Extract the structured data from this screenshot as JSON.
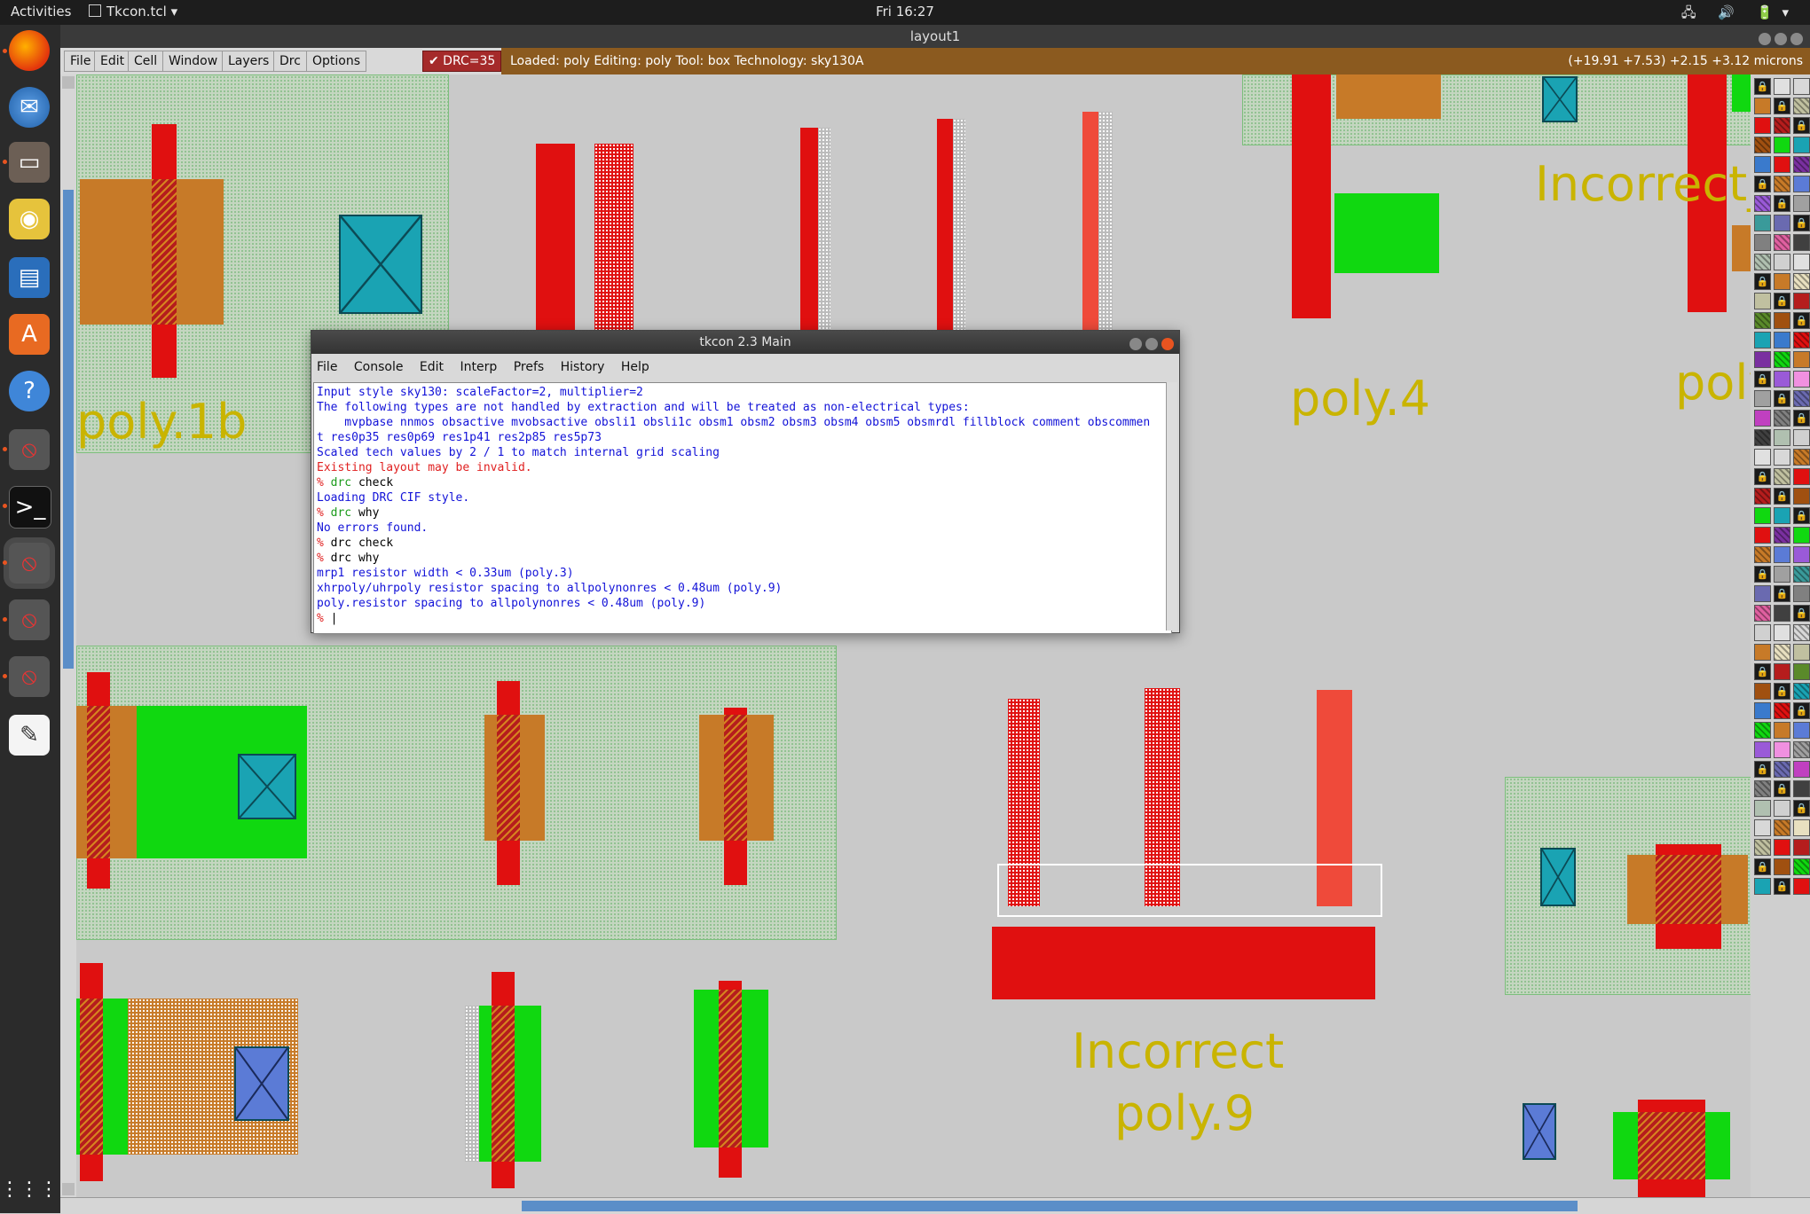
{
  "topbar": {
    "activities": "Activities",
    "app_menu": "Tkcon.tcl ▾",
    "clock": "Fri 16:27",
    "tray": "🖧 🔊 🔋▾"
  },
  "dock": {
    "icons": [
      "firefox-icon",
      "thunderbird-icon",
      "files-icon",
      "rhythmbox-icon",
      "libreoffice-writer-icon",
      "software-center-icon",
      "help-icon",
      "tk-app-icon",
      "terminal-icon",
      "tk-app-icon",
      "tk-app-icon",
      "tk-app-icon",
      "text-editor-icon",
      "show-apps-icon"
    ]
  },
  "window": {
    "title": "layout1"
  },
  "menubar": {
    "items": [
      "File",
      "Edit",
      "Cell",
      "Window",
      "Layers",
      "Drc",
      "Options"
    ],
    "drc_badge": "✔ DRC=35",
    "status": "Loaded: poly Editing: poly Tool: box  Technology: sky130A",
    "coords": "(+19.91 +7.53) +2.15 +3.12 microns"
  },
  "canvas": {
    "labels": {
      "poly1b": "poly.1b",
      "poly4": "poly.4",
      "poly_right": "poly",
      "incorrect_top": "Incorrect_",
      "incorrect_bottom": "Incorrect",
      "poly9": "poly.9"
    }
  },
  "tkcon": {
    "title": "tkcon 2.3 Main",
    "menu": [
      "File",
      "Console",
      "Edit",
      "Interp",
      "Prefs",
      "History",
      "Help"
    ],
    "lines": [
      {
        "prompt": "",
        "cmd": "",
        "text": "Input style sky130: scaleFactor=2, multiplier=2",
        "color": "blue"
      },
      {
        "prompt": "",
        "cmd": "",
        "text": "The following types are not handled by extraction and will be treated as non-electrical types:",
        "color": "blue"
      },
      {
        "prompt": "",
        "cmd": "",
        "text": "    mvpbase nnmos obsactive mvobsactive obsli1 obsli1c obsm1 obsm2 obsm3 obsm4 obsm5 obsmrdl fillblock comment obscommen",
        "color": "blue"
      },
      {
        "prompt": "",
        "cmd": "",
        "text": "t res0p35 res0p69 res1p41 res2p85 res5p73",
        "color": "blue"
      },
      {
        "prompt": "",
        "cmd": "",
        "text": "Scaled tech values by 2 / 1 to match internal grid scaling",
        "color": "blue"
      },
      {
        "prompt": "",
        "cmd": "",
        "text": "Existing layout may be invalid.",
        "color": "red"
      },
      {
        "prompt": "% ",
        "cmd": "drc",
        "text": " check",
        "color": "cmd"
      },
      {
        "prompt": "",
        "cmd": "",
        "text": "Loading DRC CIF style.",
        "color": "blue"
      },
      {
        "prompt": "% ",
        "cmd": "drc",
        "text": " why",
        "color": "cmd"
      },
      {
        "prompt": "",
        "cmd": "",
        "text": "No errors found.",
        "color": "blue"
      },
      {
        "prompt": "% ",
        "cmd": "",
        "text": "drc check",
        "color": "black"
      },
      {
        "prompt": "% ",
        "cmd": "",
        "text": "drc why",
        "color": "black"
      },
      {
        "prompt": "",
        "cmd": "",
        "text": "mrp1 resistor width < 0.33um (poly.3)",
        "color": "blue"
      },
      {
        "prompt": "",
        "cmd": "",
        "text": "xhrpoly/uhrpoly resistor spacing to allpolynonres < 0.48um (poly.9)",
        "color": "blue"
      },
      {
        "prompt": "",
        "cmd": "",
        "text": "poly.resistor spacing to allpolynonres < 0.48um (poly.9)",
        "color": "blue"
      },
      {
        "prompt": "% ",
        "cmd": "",
        "text": "",
        "color": "black"
      }
    ]
  }
}
